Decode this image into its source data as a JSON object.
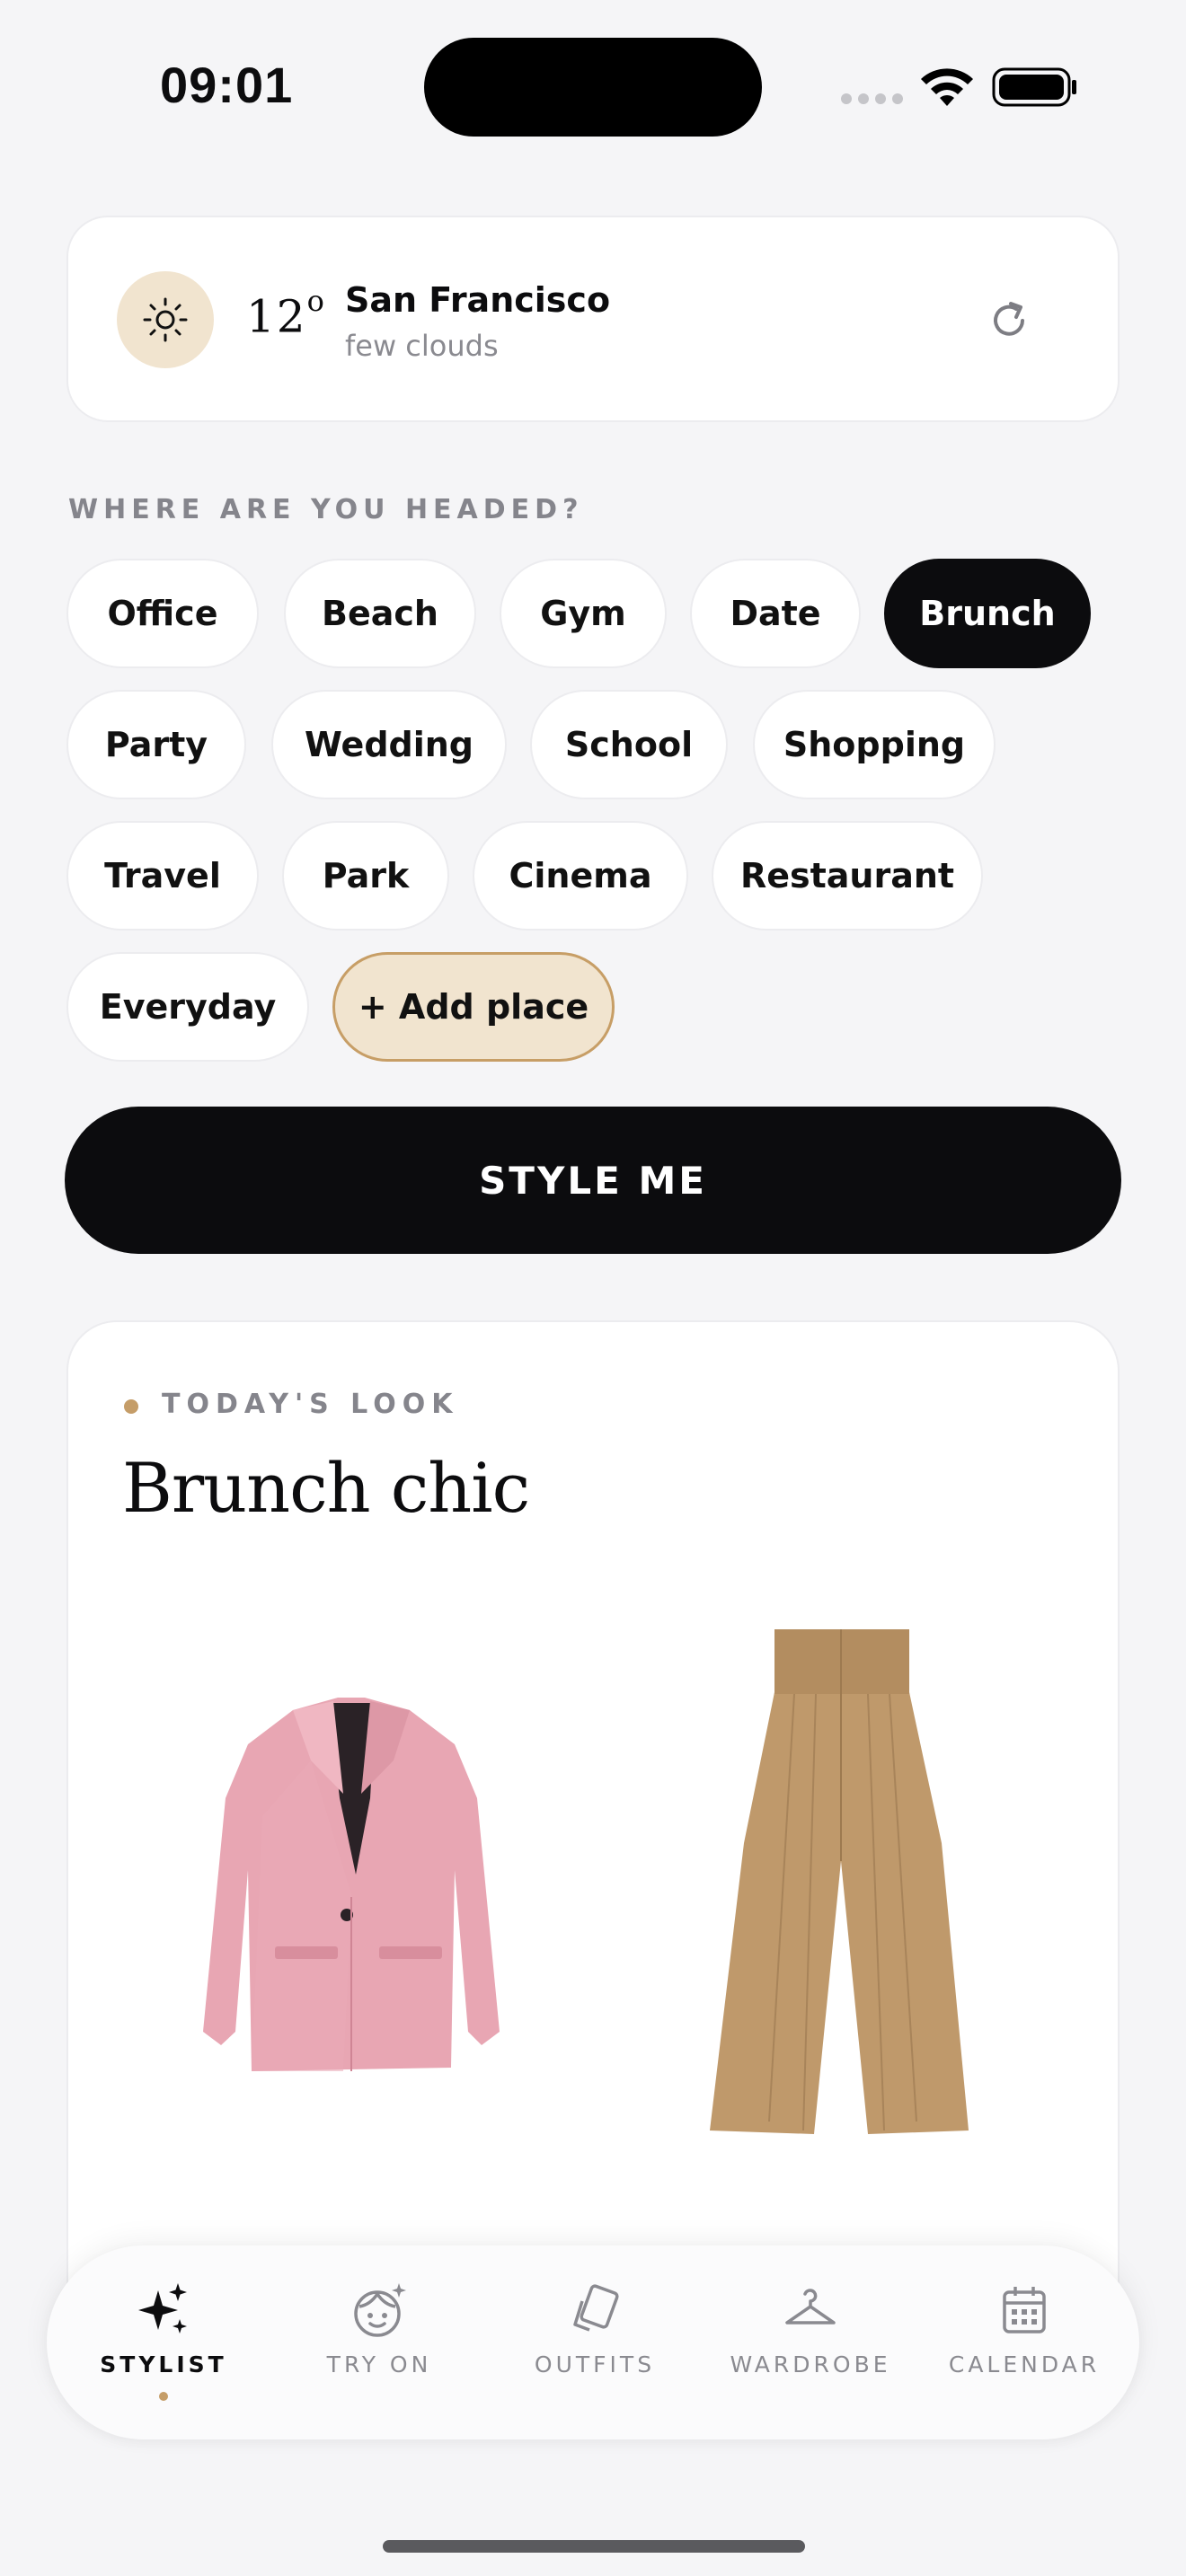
{
  "status_bar": {
    "time": "09:01"
  },
  "weather": {
    "icon": "sun-icon",
    "temperature": "12",
    "degree": "o",
    "city": "San Francisco",
    "condition": "few clouds",
    "refresh_icon": "refresh-icon"
  },
  "places": {
    "heading": "WHERE ARE YOU HEADED?",
    "chips": [
      "Office",
      "Beach",
      "Gym",
      "Date",
      "Brunch",
      "Party",
      "Wedding",
      "School",
      "Shopping",
      "Travel",
      "Park",
      "Cinema",
      "Restaurant",
      "Everyday"
    ],
    "selected": "Brunch",
    "add_label": "+ Add place"
  },
  "style_button": {
    "label": "STYLE ME"
  },
  "look": {
    "label": "TODAY'S LOOK",
    "title": "Brunch chic",
    "items": [
      "pink-blazer",
      "tan-wide-leg-trousers"
    ]
  },
  "tabs": [
    {
      "label": "STYLIST",
      "icon": "sparkles-icon",
      "active": true
    },
    {
      "label": "TRY ON",
      "icon": "face-icon",
      "active": false
    },
    {
      "label": "OUTFITS",
      "icon": "cards-icon",
      "active": false
    },
    {
      "label": "WARDROBE",
      "icon": "hanger-icon",
      "active": false
    },
    {
      "label": "CALENDAR",
      "icon": "calendar-icon",
      "active": false
    }
  ],
  "colors": {
    "accent": "#c59d68",
    "active_chip": "#0c0c0e",
    "add_chip": "#f1e4cf"
  }
}
